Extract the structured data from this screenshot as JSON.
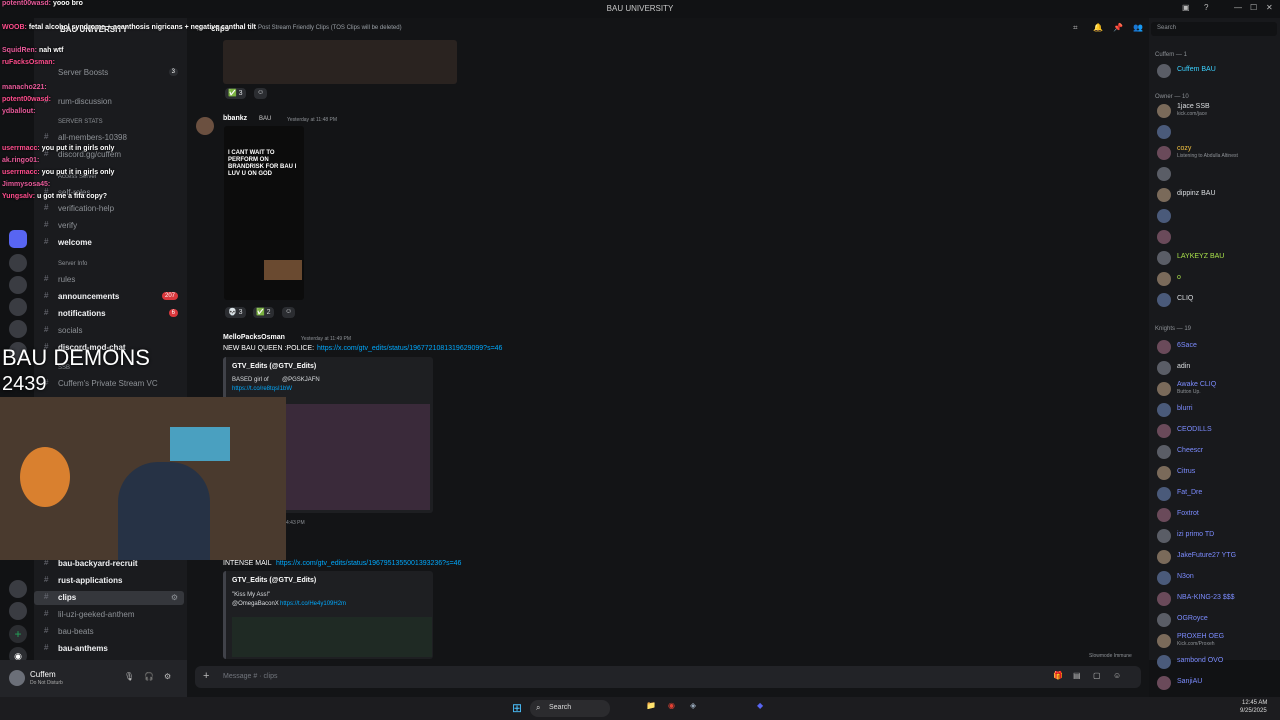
{
  "window": {
    "title": "BAU UNIVERSITY",
    "search_placeholder": "Search"
  },
  "server": {
    "name": "BAU UNIVERSITY"
  },
  "channels": [
    {
      "label": "Server Boosts",
      "badge": "3",
      "type": "item"
    },
    {
      "label": "rum-discussion",
      "type": "channel"
    },
    {
      "label": "SERVER STATS",
      "type": "category"
    },
    {
      "label": "all-members-10398",
      "type": "channel"
    },
    {
      "label": "discord.gg/cuffem",
      "type": "channel"
    },
    {
      "label": "Access Server",
      "type": "category"
    },
    {
      "label": "self-roles",
      "type": "channel"
    },
    {
      "label": "verification-help",
      "type": "channel"
    },
    {
      "label": "verify",
      "type": "channel"
    },
    {
      "label": "welcome",
      "type": "channel",
      "bright": true
    },
    {
      "label": "Server Info",
      "type": "category"
    },
    {
      "label": "rules",
      "type": "channel"
    },
    {
      "label": "announcements",
      "badge": "207",
      "type": "channel",
      "bright": true
    },
    {
      "label": "notifications",
      "badge": "6",
      "type": "channel",
      "bright": true
    },
    {
      "label": "socials",
      "type": "channel"
    },
    {
      "label": "discord-mod-chat",
      "type": "channel",
      "bright": true
    },
    {
      "label": "SSB",
      "type": "category"
    },
    {
      "label": "Cuffem's Private Stream VC",
      "type": "channel"
    }
  ],
  "channels_lower": [
    {
      "label": "bau-backyard-recruit",
      "bright": true
    },
    {
      "label": "rust-applications",
      "bright": true
    },
    {
      "label": "clips",
      "bright": true
    },
    {
      "label": "lil-uzi-geeked-anthem"
    },
    {
      "label": "bau-beats"
    },
    {
      "label": "bau-anthems",
      "bright": true
    }
  ],
  "channel_header": {
    "name": "clips",
    "topic": "Post Stream Friendly Clips (TOS Clips will be deleted)"
  },
  "messages": {
    "first_reactions": [
      "✅ 3"
    ],
    "bbankz": {
      "author": "bbankz",
      "tag": "BAU",
      "time": "Yesterday at 11:48 PM",
      "image_text": "I CANT WAIT TO PERFORM ON BRANDRISK FOR BAU I LUV U ON GOD",
      "reactions": [
        "💀 3",
        "✅ 2"
      ]
    },
    "mello": {
      "author": "MelloPacksOsman",
      "time": "Yesterday at 11:49 PM",
      "text": "NEW BAU QUEEN :POLICE:",
      "link": "https://x.com/gtv_edits/status/1967721081319629099?s=46"
    },
    "embed1": {
      "author": "GTV_Edits (@GTV_Edits)",
      "text": "BASED girl of",
      "tag": "@PGSKJAFN",
      "link": "https://t.co/re8tqsI1bW"
    },
    "time_mark": "4:43 PM",
    "second": {
      "text": "INTENSE MAIL",
      "link": "https://x.com/gtv_edits/status/1967951355001393236?s=46"
    },
    "embed2": {
      "author": "GTV_Edits (@GTV_Edits)",
      "text": "\"Kiss My Ass!\"",
      "mention": "@OmegaBaconX",
      "link": "https://t.co/He4y109H2m"
    },
    "slowmode": "Slowmode Immune"
  },
  "composer": {
    "placeholder": "Message # · clips"
  },
  "user": {
    "name": "Cuffem",
    "status": "Do Not Disturb"
  },
  "members": {
    "categories": {
      "c1": "Cuffem — 1",
      "c2": "Owner — 10",
      "c3": "Knights — 19"
    },
    "top": [
      {
        "name": "Cuffem",
        "tag": "BAU",
        "color": "#3bd1ff"
      }
    ],
    "owners": [
      {
        "name": "1jace",
        "tag": "SSB",
        "sub": "kick.com/jace",
        "color": "#dbdee1"
      },
      {
        "name": "",
        "color": "#dbdee1"
      },
      {
        "name": "cozy",
        "sub": "Listening to Abdulla Altinest",
        "color": "#f0c040"
      },
      {
        "name": "",
        "color": "#dbdee1"
      },
      {
        "name": "dippinz",
        "tag": "BAU",
        "color": "#dbdee1"
      },
      {
        "name": "",
        "color": "#dbdee1"
      },
      {
        "name": "",
        "color": "#dbdee1"
      },
      {
        "name": "LAYKEYZ",
        "tag": "BAU",
        "color": "#a8e04a"
      },
      {
        "name": "o",
        "color": "#a8e04a"
      },
      {
        "name": "",
        "tag": "CLIQ",
        "color": "#dbdee1"
      }
    ],
    "knights": [
      {
        "name": "6Sace",
        "color": "#7c8cff"
      },
      {
        "name": "adin",
        "color": "#dbdee1"
      },
      {
        "name": "Awake",
        "tag": "CLIQ",
        "sub": "Button Up.",
        "color": "#7c8cff"
      },
      {
        "name": "blurri",
        "color": "#7c8cff"
      },
      {
        "name": "CEODILLS",
        "color": "#7c8cff"
      },
      {
        "name": "Cheescr",
        "color": "#7c8cff"
      },
      {
        "name": "Citrus",
        "color": "#7c8cff"
      },
      {
        "name": "Fat_Dre",
        "color": "#7c8cff"
      },
      {
        "name": "Foxtrot",
        "color": "#7c8cff"
      },
      {
        "name": "izi primo",
        "tag": "TD",
        "color": "#7c8cff"
      },
      {
        "name": "JakeFuture27",
        "tag": "YTG",
        "color": "#7c8cff"
      },
      {
        "name": "N3on",
        "color": "#7c8cff"
      },
      {
        "name": "NBA-KING-23",
        "tag": "$$$",
        "color": "#7c8cff"
      },
      {
        "name": "OGRoyce",
        "color": "#7c8cff"
      },
      {
        "name": "PROXEH",
        "tag": "OEG",
        "sub": "Kick.com/Proxeh",
        "color": "#7c8cff"
      },
      {
        "name": "sambond",
        "tag": "OVO",
        "color": "#7c8cff"
      },
      {
        "name": "SanjiAU",
        "color": "#7c8cff"
      }
    ]
  },
  "overlay": {
    "title": "BAU DEMONS",
    "count": "2439",
    "chat": [
      {
        "user": "potent00wasd:",
        "text": "yooo bro"
      },
      {
        "user": "WOOB:",
        "text": "fetal alcohol syndrome + acanthosis nigricans + negative canthal tilt"
      },
      {
        "user": "SquidRen:",
        "text": "nah wtf"
      },
      {
        "user": "ruFacksOsman:",
        "text": ""
      },
      {
        "user": "manacho221:",
        "text": ""
      },
      {
        "user": "potent00wasd:",
        "text": ""
      },
      {
        "user": "ydballout:",
        "text": ""
      },
      {
        "user": "userrmacc:",
        "text": "you put it in girls only"
      },
      {
        "user": "ak.ringo01:",
        "text": ""
      },
      {
        "user": "userrmacc:",
        "text": "you put it in girls only"
      },
      {
        "user": "Jimmysosa45:",
        "text": ""
      },
      {
        "user": "Yungsalv:",
        "text": "u got me a fifa copy?"
      }
    ]
  },
  "taskbar": {
    "search": "Search",
    "time": "12:45 AM",
    "date": "9/25/2025"
  },
  "colors": {
    "accent": "#5865f2",
    "link": "#00a8fc",
    "badge": "#da373c"
  }
}
